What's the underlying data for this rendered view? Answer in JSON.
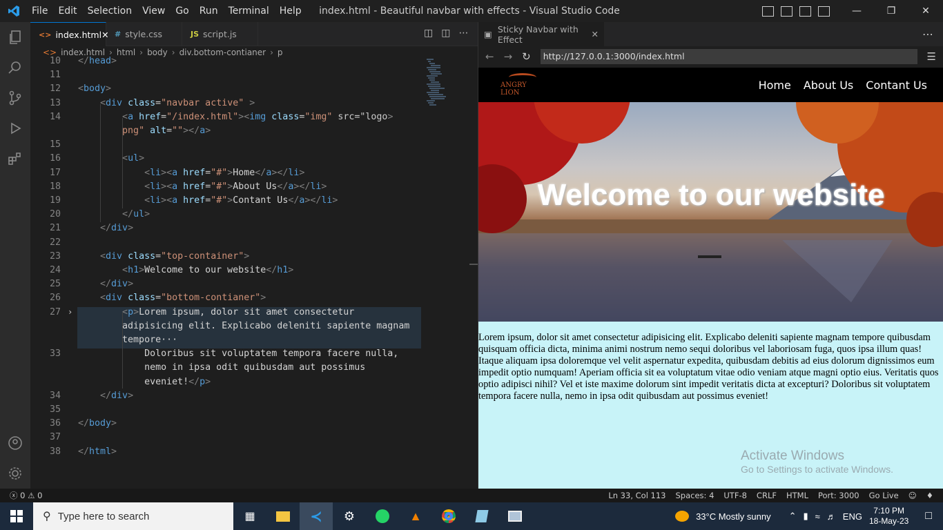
{
  "window": {
    "title": "index.html - Beautiful navbar with effects - Visual Studio Code"
  },
  "menu": [
    "File",
    "Edit",
    "Selection",
    "View",
    "Go",
    "Run",
    "Terminal",
    "Help"
  ],
  "tabs": [
    {
      "label": "index.html",
      "icon": "<>"
    },
    {
      "label": "style.css",
      "icon": "#"
    },
    {
      "label": "script.js",
      "icon": "JS"
    }
  ],
  "breadcrumb": [
    "index.html",
    "html",
    "body",
    "div.bottom-contianer",
    "p"
  ],
  "code_lines": [
    {
      "n": "10",
      "text": "</head>"
    },
    {
      "n": "11",
      "text": ""
    },
    {
      "n": "12",
      "text": "<body>"
    },
    {
      "n": "13",
      "text": "    <div class=\"navbar active\" >"
    },
    {
      "n": "14",
      "text": "        <a href=\"/index.html\"><img class=\"img\" src=\"logo."
    },
    {
      "n": "",
      "text": "        png\" alt=\"\"></a>"
    },
    {
      "n": "15",
      "text": ""
    },
    {
      "n": "16",
      "text": "        <ul>"
    },
    {
      "n": "17",
      "text": "            <li><a href=\"#\">Home</a></li>"
    },
    {
      "n": "18",
      "text": "            <li><a href=\"#\">About Us</a></li>"
    },
    {
      "n": "19",
      "text": "            <li><a href=\"#\">Contant Us</a></li>"
    },
    {
      "n": "20",
      "text": "        </ul>"
    },
    {
      "n": "21",
      "text": "    </div>"
    },
    {
      "n": "22",
      "text": ""
    },
    {
      "n": "23",
      "text": "    <div class=\"top-container\">"
    },
    {
      "n": "24",
      "text": "        <h1>Welcome to our website</h1>"
    },
    {
      "n": "25",
      "text": "    </div>"
    },
    {
      "n": "26",
      "text": "    <div class=\"bottom-contianer\">"
    },
    {
      "n": "27",
      "text": "        <p>Lorem ipsum, dolor sit amet consectetur"
    },
    {
      "n": "",
      "text": "        adipisicing elit. Explicabo deleniti sapiente magnam"
    },
    {
      "n": "",
      "text": "        tempore···"
    },
    {
      "n": "33",
      "text": "            Doloribus sit voluptatem tempora facere nulla,"
    },
    {
      "n": "",
      "text": "            nemo in ipsa odit quibusdam aut possimus"
    },
    {
      "n": "",
      "text": "            eveniet!</p>"
    },
    {
      "n": "34",
      "text": "    </div>"
    },
    {
      "n": "35",
      "text": ""
    },
    {
      "n": "36",
      "text": "</body>"
    },
    {
      "n": "37",
      "text": ""
    },
    {
      "n": "38",
      "text": "</html>"
    }
  ],
  "preview": {
    "tab_label": "Sticky Navbar with Effect",
    "url": "http://127.0.0.1:3000/index.html",
    "brand": "ANGRY LION",
    "nav_links": [
      "Home",
      "About Us",
      "Contant Us"
    ],
    "hero_title": "Welcome to our website",
    "body_text": "Lorem ipsum, dolor sit amet consectetur adipisicing elit. Explicabo deleniti sapiente magnam tempore quibusdam quisquam officia dicta, minima animi nostrum nemo sequi doloribus vel laboriosam fuga, quos ipsa illum quas! Itaque aliquam ipsa doloremque vel velit aspernatur expedita, quibusdam debitis ad eius dolorum dignissimos eum impedit optio numquam! Aperiam officia sit ea voluptatum vitae odio veniam atque magni optio eius. Veritatis quos optio adipisci nihil? Vel et iste maxime dolorum sint impedit veritatis dicta at excepturi? Doloribus sit voluptatem tempora facere nulla, nemo in ipsa odit quibusdam aut possimus eveniet!",
    "watermark_title": "Activate Windows",
    "watermark_sub": "Go to Settings to activate Windows."
  },
  "status": {
    "problems": "ⓧ 0 ⚠ 0",
    "position": "Ln 33, Col 113",
    "spaces": "Spaces: 4",
    "encoding": "UTF-8",
    "eol": "CRLF",
    "language": "HTML",
    "port": "Port: 3000",
    "golive": "Go Live"
  },
  "taskbar": {
    "search_placeholder": "Type here to search",
    "weather": "33°C  Mostly sunny",
    "lang": "ENG",
    "time": "7:10 PM",
    "date": "18-May-23"
  },
  "colors": {
    "accent": "#0078d4",
    "preview_bg": "#c8f3f8"
  }
}
